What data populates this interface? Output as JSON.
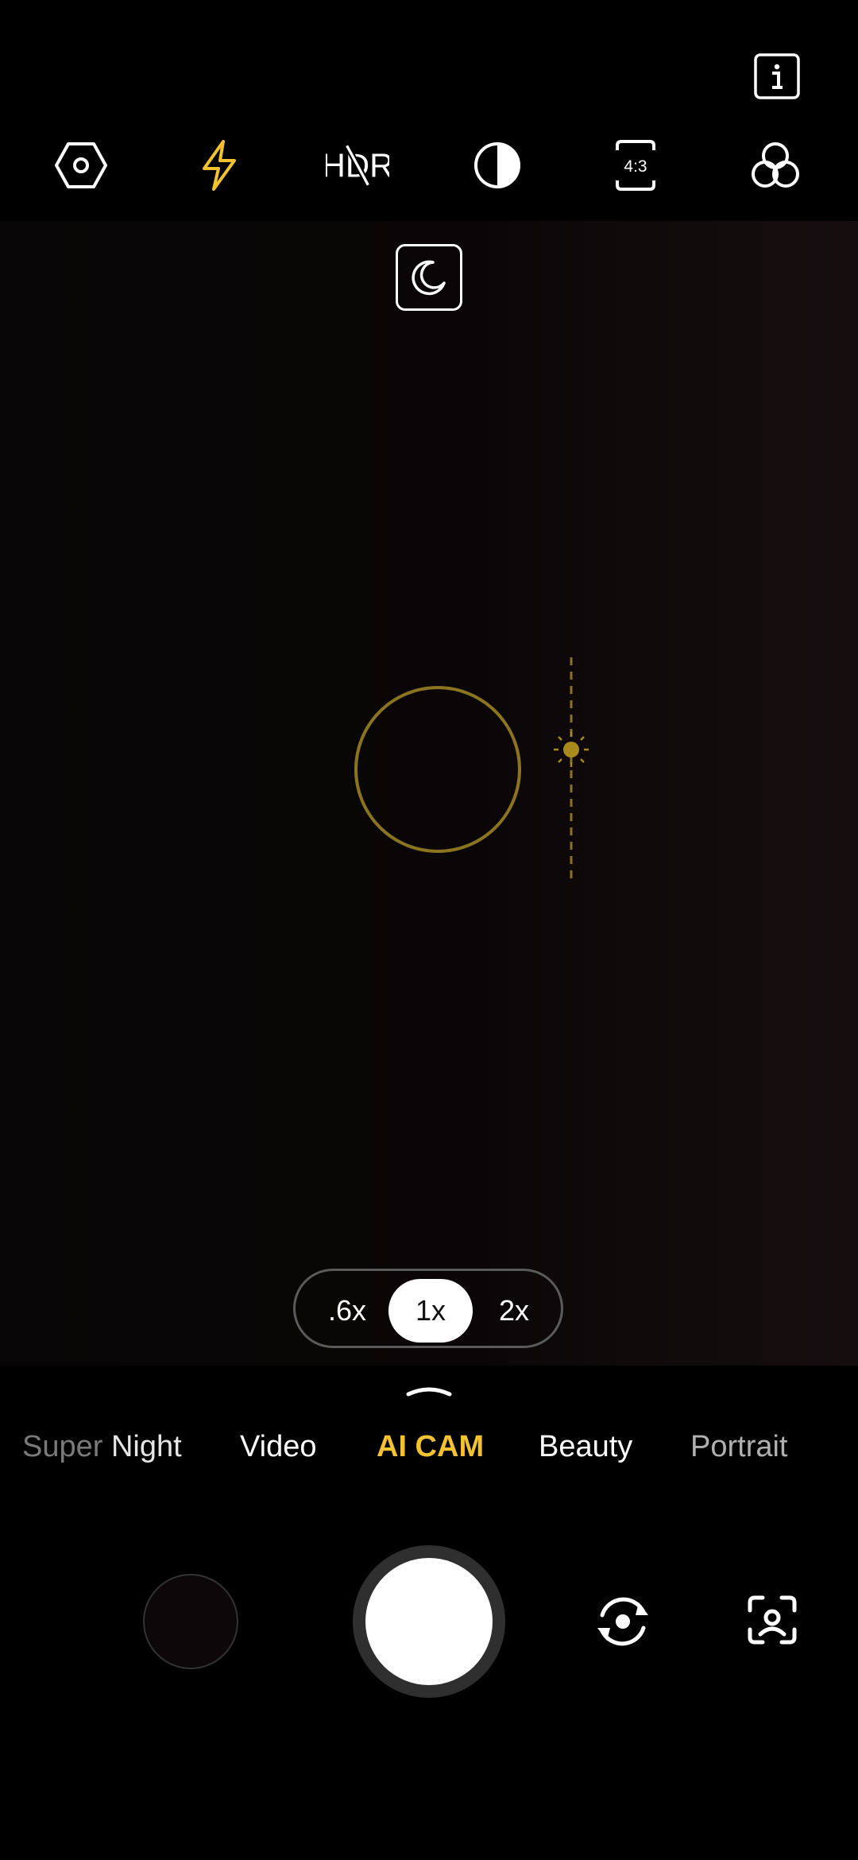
{
  "topbar": {
    "icons": {
      "info": "info-icon",
      "settings": "settings-hexagon-icon",
      "flash": "flash-icon",
      "hdr": "hdr-off-icon",
      "filter": "contrast-filter-icon",
      "ratio": "aspect-ratio-icon",
      "effects": "color-effects-icon"
    },
    "hdr_label": "HDR",
    "ratio_label": "4:3",
    "flash_color": "#f2c230"
  },
  "viewfinder": {
    "night_icon": "night-mode-moon-icon",
    "focus_color": "#8a7420",
    "exposure_icon": "exposure-sun-icon"
  },
  "zoom": {
    "options": [
      ".6x",
      "1x",
      "2x"
    ],
    "selected": "1x"
  },
  "modes": {
    "items": [
      {
        "label_faded": "Super",
        "label": " Night"
      },
      {
        "label": "Video"
      },
      {
        "label": "AI CAM"
      },
      {
        "label": "Beauty"
      },
      {
        "label": "Portrait"
      }
    ],
    "selected": "AI CAM",
    "accent": "#f2c230"
  },
  "controls": {
    "gallery": "gallery-thumbnail",
    "shutter": "shutter-button",
    "switch_camera_icon": "switch-camera-icon",
    "lens_icon": "lens-scan-icon"
  }
}
